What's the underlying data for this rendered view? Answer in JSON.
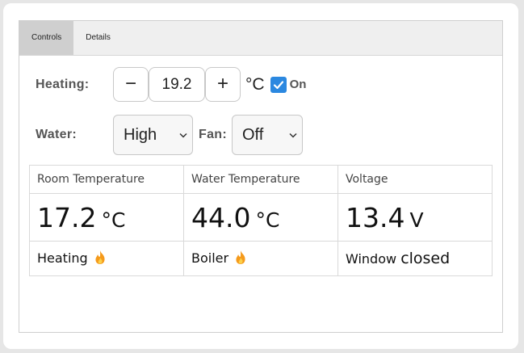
{
  "tabs": [
    {
      "label": "Controls",
      "active": true
    },
    {
      "label": "Details",
      "active": false
    }
  ],
  "heating": {
    "label": "Heating:",
    "value": "19.2",
    "minus": "−",
    "plus": "+",
    "unit": "°C",
    "checkbox_checked": true,
    "checkbox_label": "On"
  },
  "water": {
    "label": "Water:",
    "selected": "High"
  },
  "fan": {
    "label": "Fan:",
    "selected": "Off"
  },
  "table": {
    "headers": [
      "Room Temperature",
      "Water Temperature",
      "Voltage"
    ],
    "values": [
      {
        "value": "17.2",
        "unit": "°C"
      },
      {
        "value": "44.0",
        "unit": "°C"
      },
      {
        "value": "13.4",
        "unit": "V"
      }
    ],
    "statuses": [
      {
        "text": "Heating",
        "icon": "flame-icon"
      },
      {
        "text": "Boiler",
        "icon": "flame-icon"
      },
      {
        "text": "Window",
        "extra": "closed"
      }
    ]
  },
  "colors": {
    "accent": "#2b88e0",
    "flame": "#f59a1b"
  }
}
